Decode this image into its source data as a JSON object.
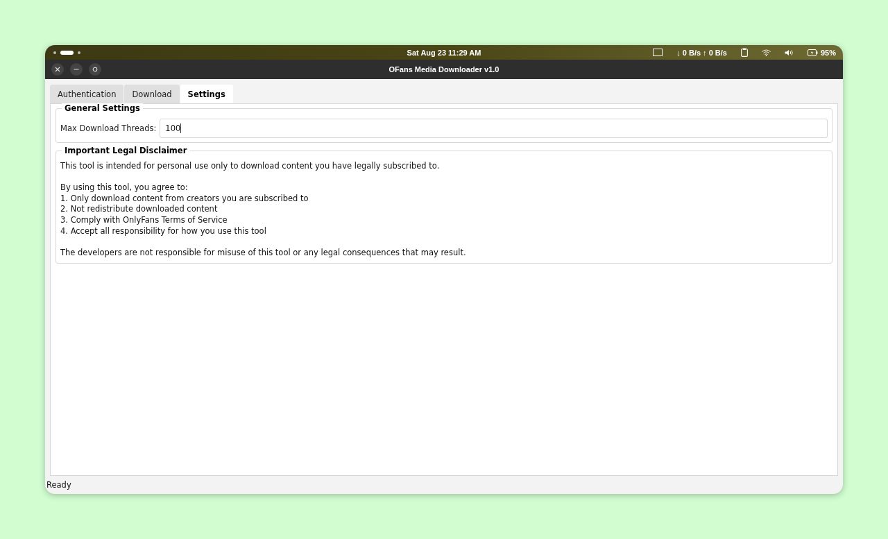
{
  "system_bar": {
    "clock": "Sat Aug 23  11:29 AM",
    "network": "↓ 0 B/s ↑ 0 B/s",
    "battery": "95%"
  },
  "window": {
    "title": "OFans Media Downloader v1.0"
  },
  "tabs": [
    {
      "label": "Authentication",
      "selected": false
    },
    {
      "label": "Download",
      "selected": false
    },
    {
      "label": "Settings",
      "selected": true
    }
  ],
  "general_settings": {
    "title": "General Settings",
    "label": "Max Download Threads:",
    "value": "100"
  },
  "disclaimer": {
    "title": "Important Legal Disclaimer",
    "intro": "This tool is intended for personal use only to download content you have legally subscribed to.",
    "lead": "By using this tool, you agree to:",
    "items": [
      "1. Only download content from creators you are subscribed to",
      "2. Not redistribute downloaded content",
      "3. Comply with OnlyFans Terms of Service",
      "4. Accept all responsibility for how you use this tool"
    ],
    "closing": "The developers are not responsible for misuse of this tool or any legal consequences that may result."
  },
  "status_bar": "Ready"
}
